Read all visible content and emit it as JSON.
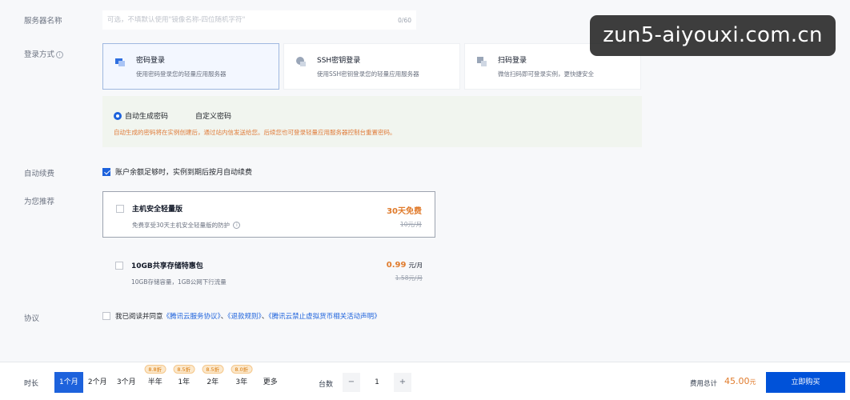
{
  "server_name": {
    "label": "服务器名称",
    "placeholder": "可选，不填默认使用\"镜像名称-四位随机字符\"",
    "counter": "0/60"
  },
  "login": {
    "label": "登录方式",
    "options": [
      {
        "title": "密码登录",
        "desc": "使用密码登录您的轻量应用服务器"
      },
      {
        "title": "SSH密钥登录",
        "desc": "使用SSH密钥登录您的轻量应用服务器"
      },
      {
        "title": "扫码登录",
        "desc": "微信扫码即可登录实例，更快捷安全"
      }
    ],
    "password_modes": [
      "自动生成密码",
      "自定义密码"
    ],
    "note": "自动生成的密码将在实例创建后，通过站内信发送给您。后续您也可登录轻量应用服务器控制台重置密码。"
  },
  "auto_renew": {
    "label": "自动续费",
    "text": "账户余额足够时，实例到期后按月自动续费"
  },
  "recommend": {
    "label": "为您推荐",
    "items": [
      {
        "title": "主机安全轻量版",
        "desc": "免费享受30天主机安全轻量版的防护",
        "price": "30天免费",
        "unit": "",
        "original": "10元/月"
      },
      {
        "title": "10GB共享存储特惠包",
        "desc": "10GB存储容量，1GB公网下行流量",
        "price": "0.99",
        "unit": "元/月",
        "original": "1.58元/月"
      }
    ]
  },
  "agreement": {
    "label": "协议",
    "prefix": "我已阅读并同意",
    "links": [
      "《腾讯云服务协议》",
      "《退款规则》",
      "《腾讯云禁止虚拟货币相关活动声明》"
    ],
    "sep": "、"
  },
  "bottom": {
    "duration_label": "时长",
    "durations": [
      {
        "label": "1个月",
        "badge": ""
      },
      {
        "label": "2个月",
        "badge": ""
      },
      {
        "label": "3个月",
        "badge": ""
      },
      {
        "label": "半年",
        "badge": "8.8折"
      },
      {
        "label": "1年",
        "badge": "8.5折"
      },
      {
        "label": "2年",
        "badge": "8.5折"
      },
      {
        "label": "3年",
        "badge": "8.0折"
      },
      {
        "label": "更多",
        "badge": ""
      }
    ],
    "quantity_label": "台数",
    "quantity": "1",
    "minus": "−",
    "plus": "+",
    "total_label": "费用总计",
    "total_value": "45.00",
    "total_unit": "元",
    "buy_label": "立即购买"
  },
  "watermark": "zun5-aiyouxi.com.cn",
  "colors": {
    "accent": "#1d62dc",
    "price": "#e07b2c",
    "buy": "#0052d9"
  }
}
